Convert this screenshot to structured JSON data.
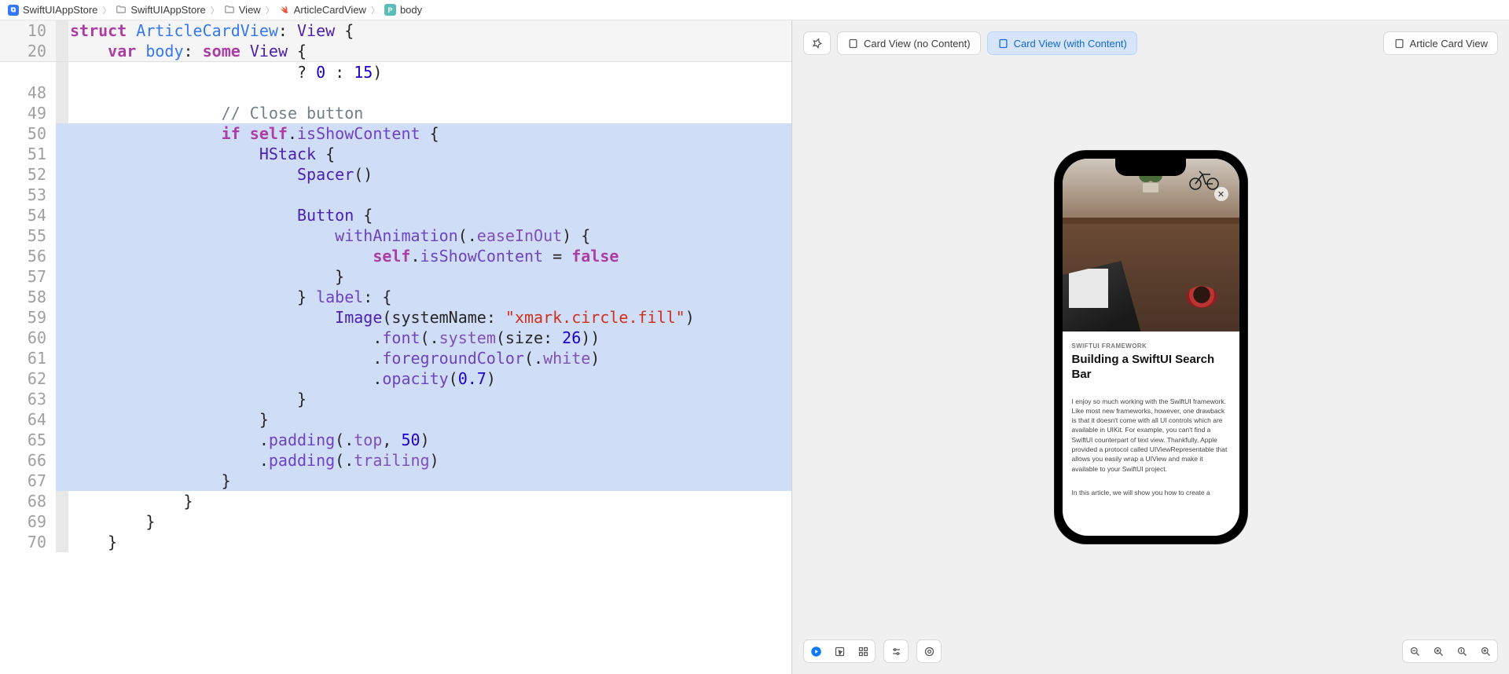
{
  "breadcrumb": [
    {
      "icon": "app",
      "label": "SwiftUIAppStore"
    },
    {
      "icon": "folder",
      "label": "SwiftUIAppStore"
    },
    {
      "icon": "folder",
      "label": "View"
    },
    {
      "icon": "swift",
      "label": "ArticleCardView"
    },
    {
      "icon": "prop",
      "label": "body"
    }
  ],
  "sticky": [
    {
      "line": "10",
      "tokens": [
        {
          "c": "tok-kw",
          "t": "struct"
        },
        {
          "c": "tok-plain",
          "t": " "
        },
        {
          "c": "tok-decl",
          "t": "ArticleCardView"
        },
        {
          "c": "tok-plain",
          "t": ": "
        },
        {
          "c": "tok-type",
          "t": "View"
        },
        {
          "c": "tok-plain",
          "t": " {"
        }
      ]
    },
    {
      "line": "20",
      "tokens": [
        {
          "c": "tok-plain",
          "t": "    "
        },
        {
          "c": "tok-kw",
          "t": "var"
        },
        {
          "c": "tok-plain",
          "t": " "
        },
        {
          "c": "tok-decl",
          "t": "body"
        },
        {
          "c": "tok-plain",
          "t": ": "
        },
        {
          "c": "tok-kw",
          "t": "some"
        },
        {
          "c": "tok-plain",
          "t": " "
        },
        {
          "c": "tok-type",
          "t": "View"
        },
        {
          "c": "tok-plain",
          "t": " {"
        }
      ]
    }
  ],
  "code": [
    {
      "line": "",
      "hl": false,
      "tokens": [
        {
          "c": "tok-plain",
          "t": "                        ? "
        },
        {
          "c": "tok-num",
          "t": "0"
        },
        {
          "c": "tok-plain",
          "t": " : "
        },
        {
          "c": "tok-num",
          "t": "15"
        },
        {
          "c": "tok-plain",
          "t": ")"
        }
      ]
    },
    {
      "line": "48",
      "hl": false,
      "tokens": [
        {
          "c": "tok-plain",
          "t": ""
        }
      ]
    },
    {
      "line": "49",
      "hl": false,
      "tokens": [
        {
          "c": "tok-plain",
          "t": "                "
        },
        {
          "c": "tok-cmt",
          "t": "// Close button"
        }
      ]
    },
    {
      "line": "50",
      "hl": true,
      "tokens": [
        {
          "c": "tok-plain",
          "t": "                "
        },
        {
          "c": "tok-kw",
          "t": "if"
        },
        {
          "c": "tok-plain",
          "t": " "
        },
        {
          "c": "tok-kw",
          "t": "self"
        },
        {
          "c": "tok-plain",
          "t": "."
        },
        {
          "c": "tok-prop",
          "t": "isShowContent"
        },
        {
          "c": "tok-plain",
          "t": " {"
        }
      ]
    },
    {
      "line": "51",
      "hl": true,
      "tokens": [
        {
          "c": "tok-plain",
          "t": "                    "
        },
        {
          "c": "tok-type",
          "t": "HStack"
        },
        {
          "c": "tok-plain",
          "t": " {"
        }
      ]
    },
    {
      "line": "52",
      "hl": true,
      "tokens": [
        {
          "c": "tok-plain",
          "t": "                        "
        },
        {
          "c": "tok-type",
          "t": "Spacer"
        },
        {
          "c": "tok-plain",
          "t": "()"
        }
      ]
    },
    {
      "line": "53",
      "hl": true,
      "tokens": [
        {
          "c": "tok-plain",
          "t": ""
        }
      ]
    },
    {
      "line": "54",
      "hl": true,
      "tokens": [
        {
          "c": "tok-plain",
          "t": "                        "
        },
        {
          "c": "tok-type",
          "t": "Button"
        },
        {
          "c": "tok-plain",
          "t": " {"
        }
      ]
    },
    {
      "line": "55",
      "hl": true,
      "tokens": [
        {
          "c": "tok-plain",
          "t": "                            "
        },
        {
          "c": "tok-fn",
          "t": "withAnimation"
        },
        {
          "c": "tok-plain",
          "t": "(."
        },
        {
          "c": "tok-enum",
          "t": "easeInOut"
        },
        {
          "c": "tok-plain",
          "t": ") {"
        }
      ]
    },
    {
      "line": "56",
      "hl": true,
      "tokens": [
        {
          "c": "tok-plain",
          "t": "                                "
        },
        {
          "c": "tok-kw",
          "t": "self"
        },
        {
          "c": "tok-plain",
          "t": "."
        },
        {
          "c": "tok-prop",
          "t": "isShowContent"
        },
        {
          "c": "tok-plain",
          "t": " = "
        },
        {
          "c": "tok-kw",
          "t": "false"
        }
      ]
    },
    {
      "line": "57",
      "hl": true,
      "tokens": [
        {
          "c": "tok-plain",
          "t": "                            }"
        }
      ]
    },
    {
      "line": "58",
      "hl": true,
      "tokens": [
        {
          "c": "tok-plain",
          "t": "                        } "
        },
        {
          "c": "tok-fn",
          "t": "label"
        },
        {
          "c": "tok-plain",
          "t": ": {"
        }
      ]
    },
    {
      "line": "59",
      "hl": true,
      "tokens": [
        {
          "c": "tok-plain",
          "t": "                            "
        },
        {
          "c": "tok-type",
          "t": "Image"
        },
        {
          "c": "tok-plain",
          "t": "(systemName: "
        },
        {
          "c": "tok-str",
          "t": "\"xmark.circle.fill\""
        },
        {
          "c": "tok-plain",
          "t": ")"
        }
      ]
    },
    {
      "line": "60",
      "hl": true,
      "tokens": [
        {
          "c": "tok-plain",
          "t": "                                ."
        },
        {
          "c": "tok-fn",
          "t": "font"
        },
        {
          "c": "tok-plain",
          "t": "(."
        },
        {
          "c": "tok-enum",
          "t": "system"
        },
        {
          "c": "tok-plain",
          "t": "(size: "
        },
        {
          "c": "tok-num",
          "t": "26"
        },
        {
          "c": "tok-plain",
          "t": "))"
        }
      ]
    },
    {
      "line": "61",
      "hl": true,
      "tokens": [
        {
          "c": "tok-plain",
          "t": "                                ."
        },
        {
          "c": "tok-fn",
          "t": "foregroundColor"
        },
        {
          "c": "tok-plain",
          "t": "(."
        },
        {
          "c": "tok-enum",
          "t": "white"
        },
        {
          "c": "tok-plain",
          "t": ")"
        }
      ]
    },
    {
      "line": "62",
      "hl": true,
      "tokens": [
        {
          "c": "tok-plain",
          "t": "                                ."
        },
        {
          "c": "tok-fn",
          "t": "opacity"
        },
        {
          "c": "tok-plain",
          "t": "("
        },
        {
          "c": "tok-num",
          "t": "0.7"
        },
        {
          "c": "tok-plain",
          "t": ")"
        }
      ]
    },
    {
      "line": "63",
      "hl": true,
      "tokens": [
        {
          "c": "tok-plain",
          "t": "                        }"
        }
      ]
    },
    {
      "line": "64",
      "hl": true,
      "tokens": [
        {
          "c": "tok-plain",
          "t": "                    }"
        }
      ]
    },
    {
      "line": "65",
      "hl": true,
      "tokens": [
        {
          "c": "tok-plain",
          "t": "                    ."
        },
        {
          "c": "tok-fn",
          "t": "padding"
        },
        {
          "c": "tok-plain",
          "t": "(."
        },
        {
          "c": "tok-enum",
          "t": "top"
        },
        {
          "c": "tok-plain",
          "t": ", "
        },
        {
          "c": "tok-num",
          "t": "50"
        },
        {
          "c": "tok-plain",
          "t": ")"
        }
      ]
    },
    {
      "line": "66",
      "hl": true,
      "tokens": [
        {
          "c": "tok-plain",
          "t": "                    ."
        },
        {
          "c": "tok-fn",
          "t": "padding"
        },
        {
          "c": "tok-plain",
          "t": "(."
        },
        {
          "c": "tok-enum",
          "t": "trailing"
        },
        {
          "c": "tok-plain",
          "t": ")"
        }
      ]
    },
    {
      "line": "67",
      "hl": true,
      "tokens": [
        {
          "c": "tok-plain",
          "t": "                }"
        }
      ]
    },
    {
      "line": "68",
      "hl": false,
      "tokens": [
        {
          "c": "tok-plain",
          "t": "            }"
        }
      ]
    },
    {
      "line": "69",
      "hl": false,
      "tokens": [
        {
          "c": "tok-plain",
          "t": "        }"
        }
      ]
    },
    {
      "line": "70",
      "hl": false,
      "tokens": [
        {
          "c": "tok-plain",
          "t": "    }"
        }
      ]
    }
  ],
  "preview_tabs": {
    "pin_icon": "pin",
    "items": [
      {
        "label": "Card View (no Content)",
        "active": false
      },
      {
        "label": "Card View (with Content)",
        "active": true
      },
      {
        "label": "Article Card View",
        "active": false
      }
    ]
  },
  "article": {
    "category": "SWIFTUI FRAMEWORK",
    "title": "Building a SwiftUI Search Bar",
    "p1": "I enjoy so much working with the SwiftUI framework. Like most new frameworks, however, one drawback is that it doesn't come with all UI controls which are available in UIKit. For example, you can't find a SwiftUI counterpart of text view. Thankfully, Apple provided a protocol called UIViewRepresentable that allows you easily wrap a UIView and make it available to your SwiftUI project.",
    "p2": "In this article, we will show you how to create a"
  }
}
